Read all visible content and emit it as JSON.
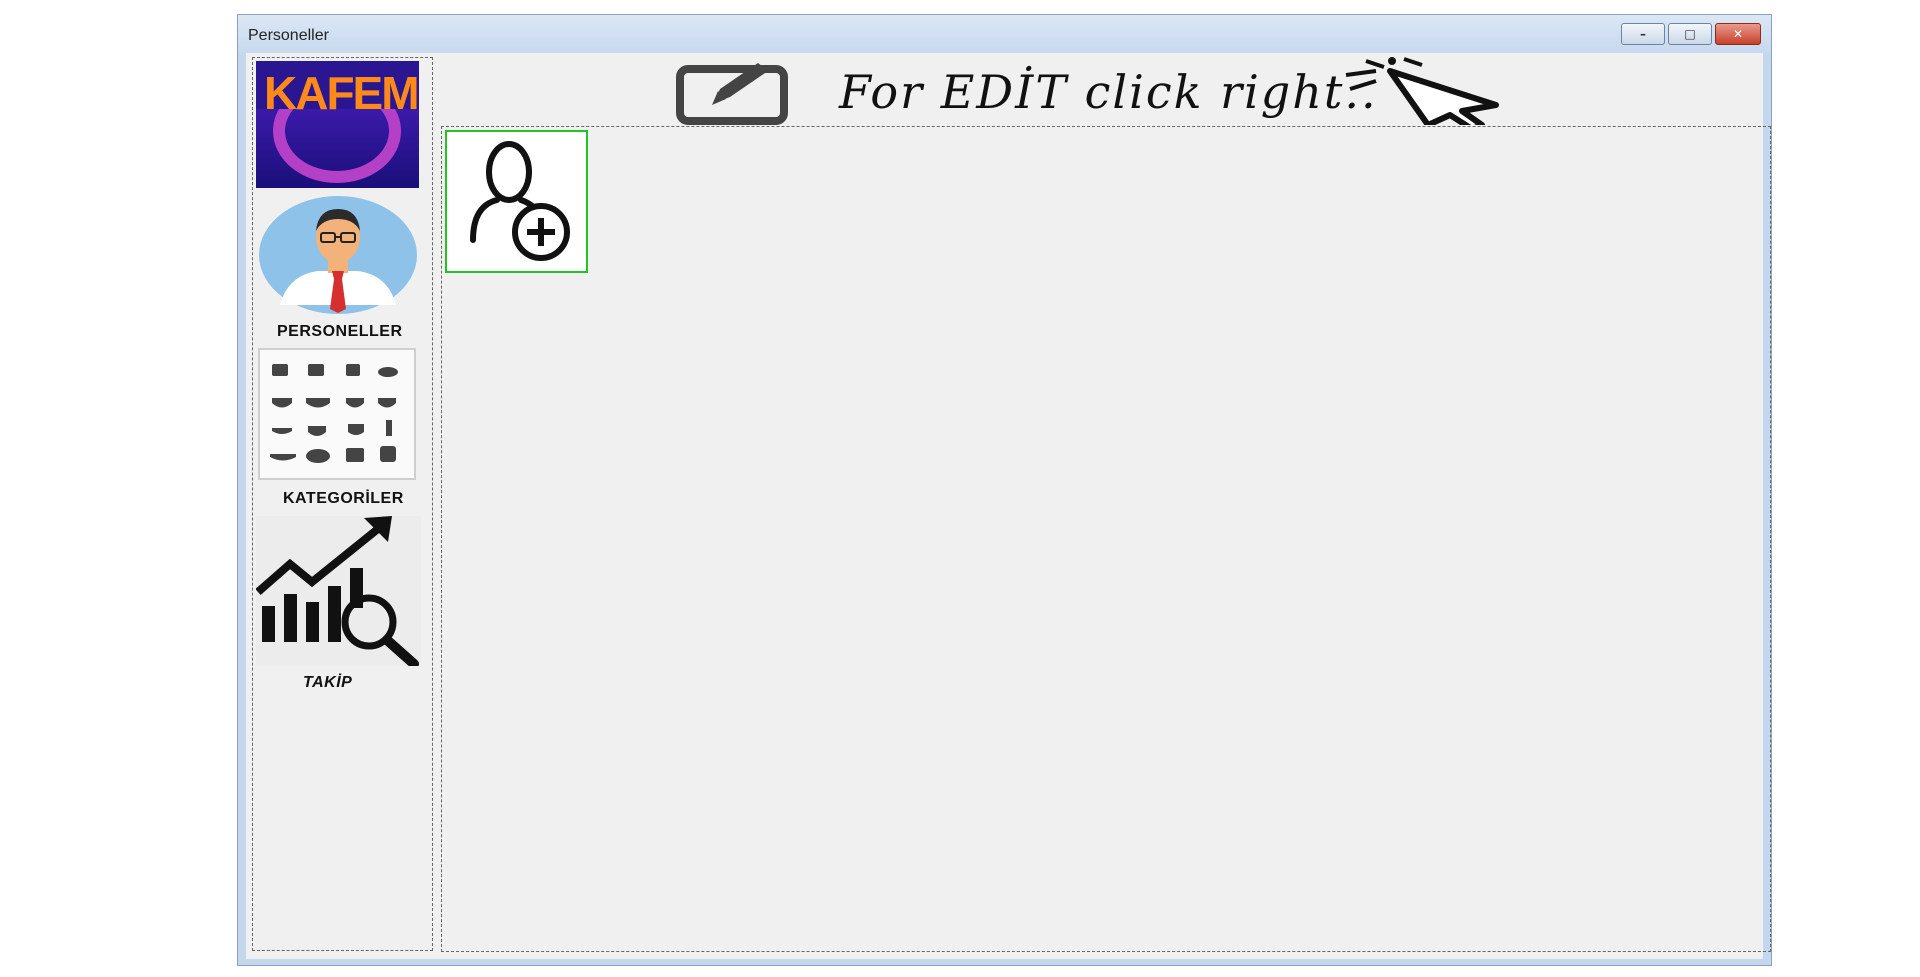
{
  "window": {
    "title": "Personeller",
    "controls": {
      "minimize": "–",
      "maximize": "□",
      "close": "✕"
    }
  },
  "sidebar": {
    "logo_text": "KAFEM",
    "items": [
      {
        "label": "PERSONELLER",
        "icon": "person-avatar-icon"
      },
      {
        "label": "KATEGORİLER",
        "icon": "coffee-grid-icon"
      },
      {
        "label": "TAKİP",
        "icon": "chart-magnifier-icon"
      }
    ]
  },
  "banner": {
    "text": "For EDİT click right..",
    "icons": [
      "edit-icon",
      "cursor-click-icon"
    ]
  },
  "main": {
    "add_tile": {
      "icon": "add-user-icon"
    }
  },
  "colors": {
    "tile_border": "#22c322",
    "logo_bg": "#2a1690",
    "avatar_bg": "#8ec2e8",
    "tie": "#d62f2f"
  }
}
